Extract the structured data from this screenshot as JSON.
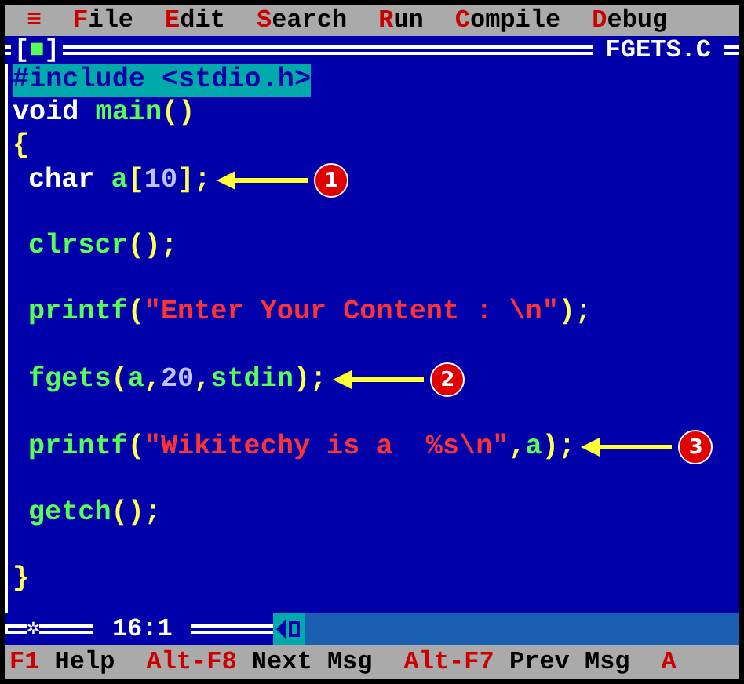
{
  "menu_bar": {
    "system_icon": "≡",
    "items": [
      {
        "hotkey": "F",
        "rest": "ile"
      },
      {
        "hotkey": "E",
        "rest": "dit"
      },
      {
        "hotkey": "S",
        "rest": "earch"
      },
      {
        "hotkey": "R",
        "rest": "un"
      },
      {
        "hotkey": "C",
        "rest": "ompile"
      },
      {
        "hotkey": "D",
        "rest": "ebug"
      }
    ]
  },
  "editor": {
    "close_box": "[■]",
    "filename": "FGETS.C",
    "position": "16:1",
    "frame_icon": "✲",
    "lines": [
      {
        "kind": "code",
        "highlighted": true,
        "tokens": [
          {
            "kind": "preproc",
            "text": "#include <stdio.h>"
          }
        ]
      },
      {
        "kind": "code",
        "highlighted": false,
        "tokens": [
          {
            "kind": "plain",
            "text": "void "
          },
          {
            "kind": "ident",
            "text": "main"
          },
          {
            "kind": "punct",
            "text": "()"
          }
        ]
      },
      {
        "kind": "code",
        "highlighted": false,
        "tokens": [
          {
            "kind": "punct",
            "text": "{"
          }
        ]
      },
      {
        "kind": "code",
        "highlighted": false,
        "indent": true,
        "callout": "1",
        "tokens": [
          {
            "kind": "plain",
            "text": "char "
          },
          {
            "kind": "ident",
            "text": "a"
          },
          {
            "kind": "punct",
            "text": "["
          },
          {
            "kind": "number",
            "text": "10"
          },
          {
            "kind": "punct",
            "text": "];"
          }
        ]
      },
      {
        "kind": "blank"
      },
      {
        "kind": "code",
        "highlighted": false,
        "indent": true,
        "tokens": [
          {
            "kind": "ident",
            "text": "clrscr"
          },
          {
            "kind": "punct",
            "text": "();"
          }
        ]
      },
      {
        "kind": "blank"
      },
      {
        "kind": "code",
        "highlighted": false,
        "indent": true,
        "tokens": [
          {
            "kind": "ident",
            "text": "printf"
          },
          {
            "kind": "punct",
            "text": "("
          },
          {
            "kind": "string",
            "text": "\"Enter Your Content : \\n\""
          },
          {
            "kind": "punct",
            "text": ");"
          }
        ]
      },
      {
        "kind": "blank"
      },
      {
        "kind": "code",
        "highlighted": false,
        "indent": true,
        "callout": "2",
        "tokens": [
          {
            "kind": "ident",
            "text": "fgets"
          },
          {
            "kind": "punct",
            "text": "("
          },
          {
            "kind": "ident",
            "text": "a"
          },
          {
            "kind": "punct",
            "text": ","
          },
          {
            "kind": "number",
            "text": "20"
          },
          {
            "kind": "punct",
            "text": ","
          },
          {
            "kind": "ident",
            "text": "stdin"
          },
          {
            "kind": "punct",
            "text": ");"
          }
        ]
      },
      {
        "kind": "blank"
      },
      {
        "kind": "code",
        "highlighted": false,
        "indent": true,
        "callout": "3",
        "tokens": [
          {
            "kind": "ident",
            "text": "printf"
          },
          {
            "kind": "punct",
            "text": "("
          },
          {
            "kind": "string",
            "text": "\"Wikitechy is a  %s\\n\""
          },
          {
            "kind": "punct",
            "text": ","
          },
          {
            "kind": "ident",
            "text": "a"
          },
          {
            "kind": "punct",
            "text": ");"
          }
        ]
      },
      {
        "kind": "blank"
      },
      {
        "kind": "code",
        "highlighted": false,
        "indent": true,
        "tokens": [
          {
            "kind": "ident",
            "text": "getch"
          },
          {
            "kind": "punct",
            "text": "();"
          }
        ]
      },
      {
        "kind": "blank"
      },
      {
        "kind": "code",
        "highlighted": false,
        "tokens": [
          {
            "kind": "punct",
            "text": "}"
          }
        ]
      }
    ]
  },
  "status_bar": [
    {
      "key": "F1",
      "label": "Help"
    },
    {
      "key": "Alt-F8",
      "label": "Next Msg"
    },
    {
      "key": "Alt-F7",
      "label": "Prev Msg"
    },
    {
      "key": "A"
    }
  ]
}
